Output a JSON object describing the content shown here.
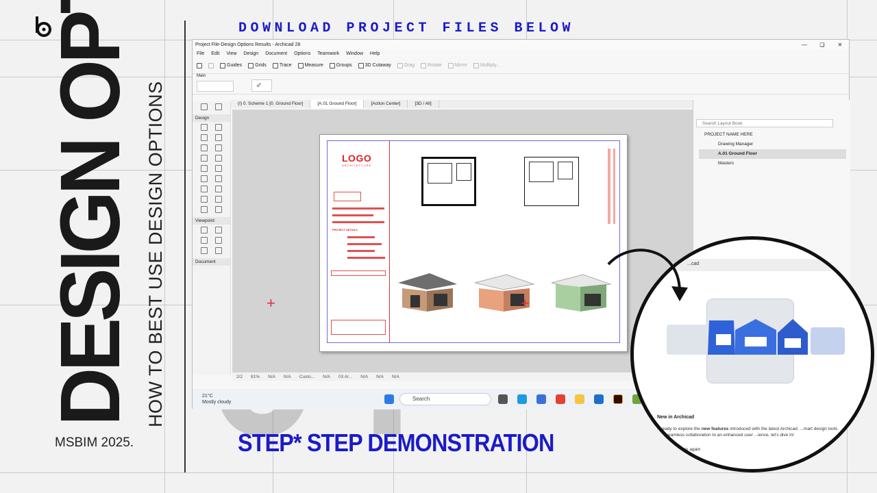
{
  "banner": {
    "download": "DOWNLOAD PROJECT FILES BELOW",
    "step": "STEP* STEP DEMONSTRATION"
  },
  "poster": {
    "title": "DESIGN OPT.",
    "subtitle": "HOW TO BEST USE DESIGN OPTIONS",
    "credit": "MSBIM 2025.",
    "episode": "04"
  },
  "app": {
    "title": "Project File-Design Options Results - Archicad 28",
    "menu": [
      "File",
      "Edit",
      "View",
      "Design",
      "Document",
      "Options",
      "Teamwork",
      "Window",
      "Help"
    ],
    "toolbar": {
      "guides": "Guides",
      "grids": "Grids",
      "trace": "Trace",
      "measure": "Measure",
      "groups": "Groups",
      "cutaway": "3D Cutaway",
      "drag": "Drag",
      "rotate": "Rotate",
      "mirror": "Mirror",
      "multiply": "Multiply..."
    },
    "main_label": "Main",
    "toolbox": {
      "design": "Design",
      "viewpoint": "Viewpoint",
      "document": "Document"
    },
    "tabs": [
      "(I) 0. Scheme 1 [0. Ground Floor]",
      "[A.01 Ground Floor]",
      "[Action Center]",
      "[3D / All]"
    ],
    "sheet": {
      "logo": "LOGO",
      "logo_sub": "ARCHITECTURE",
      "project_details": "PROJECT DETAILS"
    },
    "status": {
      "page": "2/2",
      "zoom": "81%",
      "na": "N/A",
      "custom": "Custo...",
      "layer": "03 Ar..."
    },
    "navigator": {
      "search_placeholder": "Search Layout Book",
      "items": [
        "PROJECT NAME HERE",
        "Drawing Manager",
        "A.01 Ground Floor",
        "Masters"
      ]
    },
    "taskbar": {
      "temp": "21°C",
      "weather": "Mostly cloudy",
      "search": "Search"
    }
  },
  "popup": {
    "header": "...cad",
    "title": "New in Archicad",
    "body_pre": "...ready to explore the ",
    "body_bold": "new features",
    "body_post": " introduced with the latest Archicad. ...mart design tools and seamless collaboration to an enhanced user ...ience, let's dive in!",
    "link": "...this again"
  }
}
